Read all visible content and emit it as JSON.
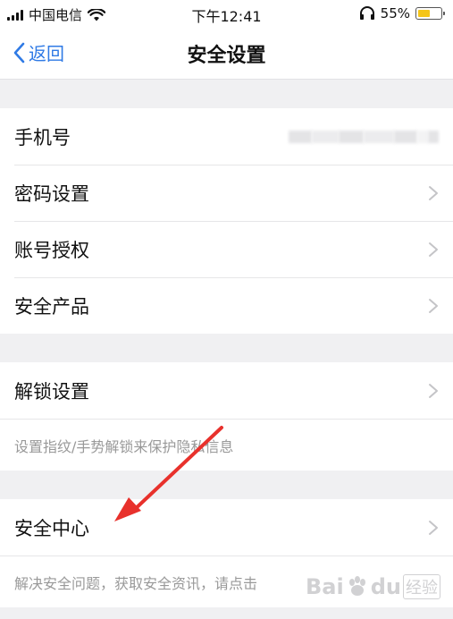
{
  "status_bar": {
    "carrier": "中国电信",
    "time": "下午12:41",
    "battery_percent": "55%",
    "battery_level": 0.55
  },
  "nav": {
    "back_label": "返回",
    "title": "安全设置"
  },
  "sections": {
    "account": [
      {
        "label": "手机号"
      },
      {
        "label": "密码设置"
      },
      {
        "label": "账号授权"
      },
      {
        "label": "安全产品"
      }
    ],
    "unlock": {
      "label": "解锁设置",
      "description": "设置指纹/手势解锁来保护隐私信息"
    },
    "center": {
      "label": "安全中心",
      "description": "解决安全问题，获取安全资讯，请点击"
    }
  },
  "watermark": {
    "brand": "Bai",
    "brand_suffix": "du",
    "jingyan": "经验"
  },
  "colors": {
    "accent": "#2f7ae5",
    "annotation_arrow": "#e8312c"
  }
}
